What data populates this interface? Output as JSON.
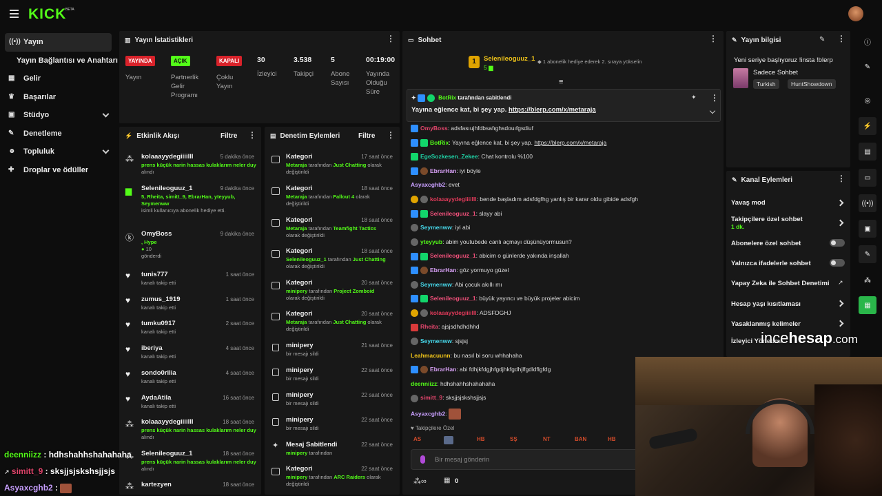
{
  "brand": {
    "logo": "KICK",
    "beta": "BETA"
  },
  "sidebar": {
    "items": [
      {
        "label": "Yayın",
        "icon": "broadcast-icon"
      },
      {
        "label": "Yayın Bağlantısı ve Anahtarı"
      },
      {
        "label": "Gelir",
        "icon": "wallet-icon"
      },
      {
        "label": "Başarılar",
        "icon": "trophy-icon"
      },
      {
        "label": "Stüdyo",
        "icon": "studio-icon"
      },
      {
        "label": "Denetleme",
        "icon": "wrench-icon"
      },
      {
        "label": "Topluluk",
        "icon": "users-icon"
      },
      {
        "label": "Droplar ve ödüller",
        "icon": "gift-icon"
      }
    ]
  },
  "stats": {
    "title": "Yayın İstatistikleri",
    "items": [
      {
        "badge": "YAYINDA",
        "label": "Yayın"
      },
      {
        "badge": "AÇIK",
        "label": "Partnerlik Gelir Programı"
      },
      {
        "badge": "KAPALI",
        "label": "Çoklu Yayın"
      },
      {
        "value": "30",
        "label": "İzleyici"
      },
      {
        "value": "3.538",
        "label": "Takipçi"
      },
      {
        "value": "5",
        "label": "Abone Sayısı"
      },
      {
        "value": "00:19:00",
        "label": "Yayında Olduğu Süre"
      }
    ]
  },
  "activity": {
    "title": "Etkinlik Akışı",
    "filter": "Filtre",
    "events": [
      {
        "icon": "gift-sub-icon",
        "name": "kolaaayydegiiiilll",
        "time": "5 dakika önce",
        "sub_green": "prens küçük narin hassas kulaklarım neler duy",
        "sub": "alındı"
      },
      {
        "icon": "kick-sub-icon",
        "name": "Selenileoguuz_1",
        "time": "9 dakika önce",
        "sub_green": "5, Rheita, simitt_9, EbrarHan, yteyyub, Seymenww",
        "sub": "isimli kullanıcıya abonelik hediye etti."
      },
      {
        "icon": "kicks-icon",
        "name": "OmyBoss",
        "time": "9 dakika önce",
        "sub_green": ", Hype",
        "sub_green2": "10",
        "sub": "gönderdi"
      },
      {
        "icon": "heart-icon",
        "name": "tunis777",
        "time": "1 saat önce",
        "sub": "kanalı takip etti"
      },
      {
        "icon": "heart-icon",
        "name": "zumus_1919",
        "time": "1 saat önce",
        "sub": "kanalı takip etti"
      },
      {
        "icon": "heart-icon",
        "name": "tumku0917",
        "time": "2 saat önce",
        "sub": "kanalı takip etti"
      },
      {
        "icon": "heart-icon",
        "name": "iberiya",
        "time": "4 saat önce",
        "sub": "kanalı takip etti"
      },
      {
        "icon": "heart-icon",
        "name": "sondo0rilia",
        "time": "4 saat önce",
        "sub": "kanalı takip etti"
      },
      {
        "icon": "heart-icon",
        "name": "AydaAtila",
        "time": "16 saat önce",
        "sub": "kanalı takip etti"
      },
      {
        "icon": "gift-sub-icon",
        "name": "kolaaayydegiiiilll",
        "time": "18 saat önce",
        "sub_green": "prens küçük narin hassas kulaklarım neler duy",
        "sub": "alındı"
      },
      {
        "icon": "gift-sub-icon",
        "name": "Selenileoguuz_1",
        "time": "18 saat önce",
        "sub_green": "prens küçük narin hassas kulaklarım neler duy",
        "sub": "alındı"
      },
      {
        "icon": "gift-sub-icon",
        "name": "kartezyen",
        "time": "18 saat önce"
      }
    ]
  },
  "moderation": {
    "title": "Denetim Eylemleri",
    "filter": "Filtre",
    "actions": [
      {
        "name": "Kategori",
        "time": "17 saat önce",
        "g1": "Metaraja",
        "t1": " tarafından ",
        "g2": "Just Chatting",
        "t2": " olarak değiştirildi"
      },
      {
        "name": "Kategori",
        "time": "18 saat önce",
        "g1": "Metaraja",
        "t1": " tarafından ",
        "g2": "Fallout 4",
        "t2": " olarak değiştirildi"
      },
      {
        "name": "Kategori",
        "time": "18 saat önce",
        "g1": "Metaraja",
        "t1": " tarafından ",
        "g2": "Teamfight Tactics",
        "t2": " olarak değiştirildi"
      },
      {
        "name": "Kategori",
        "time": "18 saat önce",
        "g1": "Selenileoguuz_1",
        "t1": " tarafından ",
        "g2": "Just Chatting",
        "t2": " olarak değiştirildi"
      },
      {
        "name": "Kategori",
        "time": "20 saat önce",
        "g1": "minipery",
        "t1": " tarafından ",
        "g2": "Project Zomboid",
        "t2": " olarak değiştirildi"
      },
      {
        "name": "Kategori",
        "time": "20 saat önce",
        "g1": "Metaraja",
        "t1": " tarafından ",
        "g2": "Just Chatting",
        "t2": " olarak değiştirildi"
      },
      {
        "name": "minipery",
        "time": "21 saat önce",
        "t1": "bir mesajı sildi"
      },
      {
        "name": "minipery",
        "time": "22 saat önce",
        "t1": "bir mesajı sildi"
      },
      {
        "name": "minipery",
        "time": "22 saat önce",
        "t1": "bir mesajı sildi"
      },
      {
        "name": "minipery",
        "time": "22 saat önce",
        "t1": "bir mesajı sildi"
      },
      {
        "name": "Mesaj Sabitlendi",
        "time": "22 saat önce",
        "g1": "minipery",
        "t1": " tarafından"
      },
      {
        "name": "Kategori",
        "time": "22 saat önce",
        "g1": "minipery",
        "t1": " tarafından ",
        "g2": "ARC Raiders",
        "t2": " olarak değiştirildi"
      }
    ]
  },
  "chat": {
    "title": "Sohbet",
    "top_gifter": {
      "name": "Selenileoguuz_1",
      "count": "5",
      "note": "1 abonelik hediye ederek 2. sıraya yükselin"
    },
    "pinned": {
      "by": "BotRix",
      "by_suffix": "tarafından sabitlendi",
      "text": "Yayına eğlence kat, bi şey yap.",
      "link": "https://blerp.com/x/metaraja"
    },
    "messages": [
      {
        "badges": [
          "blue"
        ],
        "user": "OmyBoss",
        "color": "#e0456b",
        "text": "adsfasıujhfdbsafıghsdouıfgsdiuf"
      },
      {
        "badges": [
          "blue",
          "green"
        ],
        "user": "BotRix",
        "color": "#53fc18",
        "text": "Yayına eğlence kat, bi şey yap. ",
        "link": "https://blerp.com/x/metaraja"
      },
      {
        "badges": [
          "green"
        ],
        "user": "EgeSozkesen_Zekee",
        "color": "#1fd1a5",
        "text": "Chat kontrolu %100"
      },
      {
        "badges": [
          "blue",
          "brown"
        ],
        "user": "EbrarHan",
        "color": "#d7a0f5",
        "text": "iyi böyle"
      },
      {
        "badges": [],
        "user": "Asyaxcghb2",
        "color": "#c9a0ff",
        "text": "evet"
      },
      {
        "badges": [
          "gold",
          "gray"
        ],
        "user": "kolaaayydegiiiilll",
        "color": "#e23a5a",
        "text": "bende başladım adsfdgfhg yanlış bir karar oldu gibide adsfgh"
      },
      {
        "badges": [
          "blue",
          "green"
        ],
        "user": "Selenileoguuz_1",
        "color": "#f0507a",
        "text": "slayy abi"
      },
      {
        "badges": [
          "gray"
        ],
        "user": "Seymenww",
        "color": "#46d6e8",
        "text": "iyi abi"
      },
      {
        "badges": [
          "gray"
        ],
        "user": "yteyyub",
        "color": "#53fc18",
        "text": "abim youtubede canlı açmayı düşünüyormusun?"
      },
      {
        "badges": [
          "blue",
          "green"
        ],
        "user": "Selenileoguuz_1",
        "color": "#f0507a",
        "text": "abicim o günlerde yakında inşallah"
      },
      {
        "badges": [
          "blue",
          "brown"
        ],
        "user": "EbrarHan",
        "color": "#d7a0f5",
        "text": "göz yormuyo güzel"
      },
      {
        "badges": [
          "gray"
        ],
        "user": "Seymenww",
        "color": "#46d6e8",
        "text": "Abi çocuk akıllı mı"
      },
      {
        "badges": [
          "blue",
          "green"
        ],
        "user": "Selenileoguuz_1",
        "color": "#f0507a",
        "text": "büyük yayıncı ve büyük projeler abicim"
      },
      {
        "badges": [
          "gold",
          "gray"
        ],
        "user": "kolaaayydegiiiilll",
        "color": "#e23a5a",
        "text": "ADSFDGHJ"
      },
      {
        "badges": [
          "red"
        ],
        "user": "Rheita",
        "color": "#e0456b",
        "text": "ajsjsdhdhdhhd"
      },
      {
        "badges": [
          "gray"
        ],
        "user": "Seymenww",
        "color": "#46d6e8",
        "text": "sjsjsj"
      },
      {
        "badges": [],
        "user": "Leahmacuunn",
        "color": "#f0c419",
        "text": "bu nasıl bi soru whhahaha"
      },
      {
        "badges": [
          "blue",
          "brown"
        ],
        "user": "EbrarHan",
        "color": "#d7a0f5",
        "text": "abi fdhjkfdgjhfgdjhkfgdhjlfgdldflgfdg"
      },
      {
        "badges": [],
        "user": "deenniizz",
        "color": "#53fc18",
        "text": "hdhshahhshahahaha"
      },
      {
        "badges": [
          "gray"
        ],
        "user": "simitt_9",
        "color": "#e0456b",
        "text": "sksjjsjskshsjjsjs"
      },
      {
        "badges": [],
        "user": "Asyaxcghb2",
        "color": "#c9a0ff",
        "text": ""
      }
    ],
    "followers_only": "Takipçilere Özel",
    "emotes": [
      "AS",
      "",
      "HB",
      "SŞ",
      "NT",
      "BAN",
      "HB"
    ],
    "input_placeholder": "Bir mesaj gönderin",
    "bottom_count": "0"
  },
  "stream_info": {
    "title": "Yayın bilgisi",
    "stream_title": "Yeni seriye başlıyoruz !insta !blerp",
    "category": "Sadece Sohbet",
    "tags": [
      "Turkish",
      "HuntShowdown"
    ]
  },
  "channel_actions": {
    "title": "Kanal Eylemleri",
    "items": [
      {
        "label": "Yavaş mod",
        "control": "chevron"
      },
      {
        "label": "Takipçilere özel sohbet",
        "value": "1 dk.",
        "control": "chevron"
      },
      {
        "label": "Abonelere özel sohbet",
        "control": "toggle"
      },
      {
        "label": "Yalnızca ifadelerle sohbet",
        "control": "toggle"
      },
      {
        "label": "Yapay Zeka ile Sohbet Denetimi",
        "control": "external"
      },
      {
        "label": "Hesap yaşı kısıtlaması",
        "control": "chevron"
      },
      {
        "label": "Yasaklanmış kelimeler",
        "control": "chevron"
      },
      {
        "label": "İzleyici Yönetimi",
        "control": "chevron"
      }
    ]
  },
  "watermark": {
    "a": "ince",
    "b": "hesap",
    "c": ".com"
  },
  "overlay_chat": [
    {
      "user": "deenniizz",
      "color": "#53fc18",
      "text": ": hdhshahhshahahaha"
    },
    {
      "user": "simitt_9",
      "color": "#e0456b",
      "text": ": sksjjsjskshsjjsjs"
    },
    {
      "user": "Asyaxcghb2",
      "color": "#c9a0ff",
      "text": ":"
    }
  ]
}
